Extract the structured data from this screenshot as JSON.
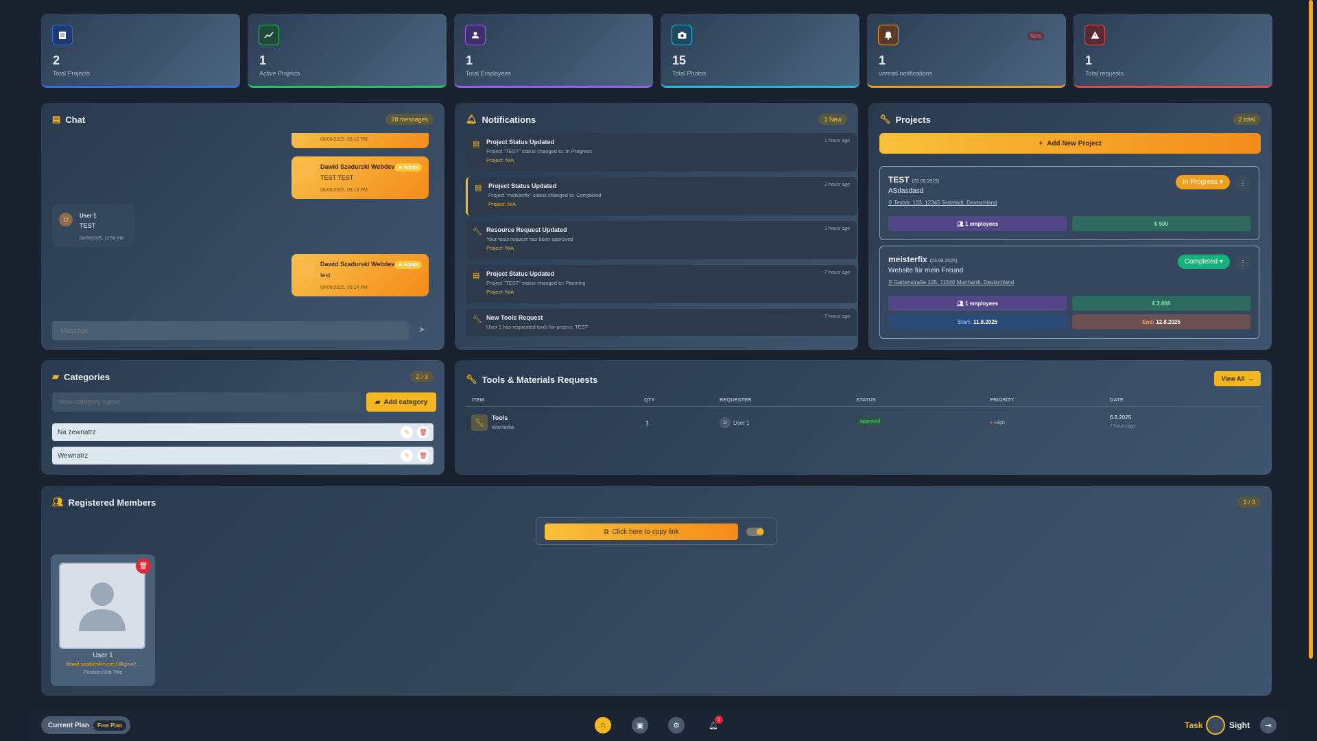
{
  "stats": [
    {
      "value": "2",
      "label": "Total Projects",
      "color": "#2f6fe0",
      "icon": "clipboard-icon"
    },
    {
      "value": "1",
      "label": "Active Projects",
      "color": "#22c55e",
      "icon": "trend-icon"
    },
    {
      "value": "1",
      "label": "Total Employees",
      "color": "#9b5cf6",
      "icon": "person-icon"
    },
    {
      "value": "15",
      "label": "Total Photos",
      "color": "#22b8e0",
      "icon": "camera-icon"
    },
    {
      "value": "1",
      "label": "unread notifications",
      "color": "#f59e0b",
      "icon": "bell-icon",
      "badge": "New"
    },
    {
      "value": "1",
      "label": "Total requests",
      "color": "#ef4444",
      "icon": "warning-icon"
    }
  ],
  "chat": {
    "title": "Chat",
    "count": "28 messages",
    "msg0": {
      "time": "08/06/2025, 09:12 PM"
    },
    "msg1": {
      "name": "Dawid Szadurski Webdev",
      "badge": "★ Admin",
      "text": "TEST TEST",
      "time": "08/06/2025, 09:13 PM"
    },
    "msg2": {
      "name": "User 1",
      "avatar": "U",
      "text": "TEST",
      "time": "08/06/2025, 12:58 PM"
    },
    "msg3": {
      "name": "Dawid Szadurski Webdev",
      "badge": "★ Admin",
      "text": "test",
      "time": "08/06/2025, 09:14 PM"
    },
    "placeholder": "Message"
  },
  "notifications": {
    "title": "Notifications",
    "count": "1 New",
    "items": [
      {
        "title": "Project Status Updated",
        "desc": "Project \"TEST\" status changed to: In Progress",
        "project": "Project: N/A",
        "time": "1 hours ago"
      },
      {
        "title": "Project Status Updated",
        "desc": "Project \"meisterfix\" status changed to: Completed",
        "project": "Project: N/A",
        "time": "2 hours ago"
      },
      {
        "title": "Resource Request Updated",
        "desc": "Your tools request has been approved",
        "project": "Project: N/A",
        "time": "3 hours ago"
      },
      {
        "title": "Project Status Updated",
        "desc": "Project \"TEST\" status changed to: Planning",
        "project": "Project: N/A",
        "time": "7 hours ago"
      },
      {
        "title": "New Tools Request",
        "desc": "User 1 has requested tools for project: TEST",
        "project": "",
        "time": "7 hours ago"
      }
    ]
  },
  "projects": {
    "title": "Projects",
    "count": "2 total",
    "add": "Add New Project",
    "p1": {
      "name": "TEST",
      "date": "(03.08.2025)",
      "desc": "ASdasdasd",
      "address": "Teststr. 123, 12345 Teststadt, Deutschland",
      "status": "In Progress ▾",
      "employees": "1 employees",
      "budget": "€ 500"
    },
    "p2": {
      "name": "meisterfix",
      "date": "(03.08.2025)",
      "desc": "Website für mein Freund",
      "address": "Gartenstraße 105, 71540 Murrhardt, Deutschland",
      "status": "Completed ▾",
      "employees": "1 employees",
      "budget": "€ 2.000",
      "start": "11.8.2025",
      "end": "12.8.2025",
      "start_label": "Start:",
      "end_label": "End:"
    }
  },
  "categories": {
    "title": "Categories",
    "count": "2 / 3",
    "placeholder": "New category name",
    "add": "Add category",
    "items": [
      "Na zewnatrz",
      "Wewnatrz"
    ]
  },
  "requests": {
    "title": "Tools & Materials Requests",
    "view_all": "View All",
    "headers": [
      "ITEM",
      "QTY",
      "REQUESTER",
      "STATUS",
      "PRIORITY",
      "DATE"
    ],
    "row": {
      "item": "Tools",
      "sub": "Wiertarka",
      "qty": "1",
      "avatar": "U",
      "requester": "User 1",
      "status": "approved",
      "priority": "High",
      "date": "6.8.2025",
      "ago": "7 hours ago"
    }
  },
  "members": {
    "title": "Registered Members",
    "count": "1 / 3",
    "copy": "Click here to copy link",
    "member": {
      "name": "User 1",
      "email": "dawid.szadurski+user1@gmail...",
      "position": "Position/Job Title"
    }
  },
  "footer": {
    "plan_label": "Current Plan",
    "plan": "Free Plan",
    "notif_count": "1",
    "brand_left": "Task",
    "brand_right": "Sight"
  }
}
